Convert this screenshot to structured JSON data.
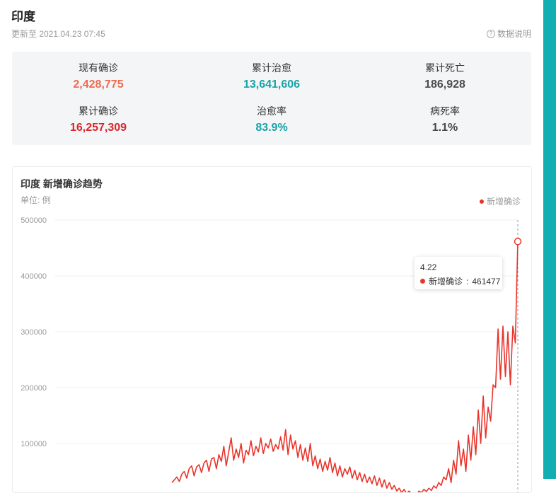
{
  "header": {
    "title": "印度",
    "update": "更新至 2021.04.23 07:45",
    "explain_label": "数据说明"
  },
  "stats": [
    {
      "label": "现有确诊",
      "value": "2,428,775",
      "color": "#f06a4f"
    },
    {
      "label": "累计治愈",
      "value": "13,641,606",
      "color": "#17a3a8"
    },
    {
      "label": "累计死亡",
      "value": "186,928",
      "color": "#4a4a4a"
    },
    {
      "label": "累计确诊",
      "value": "16,257,309",
      "color": "#d8262b"
    },
    {
      "label": "治愈率",
      "value": "83.9%",
      "color": "#17a3a8"
    },
    {
      "label": "病死率",
      "value": "1.1%",
      "color": "#4a4a4a"
    }
  ],
  "chart_card": {
    "title": "印度 新增确诊趋势",
    "unit": "单位: 例",
    "legend": "新增确诊",
    "tooltip": {
      "date": "4.22",
      "series": "新增确诊",
      "value": "461477"
    }
  },
  "chart_data": {
    "type": "line",
    "series_color": "#e9342c",
    "ylim": [
      0,
      500000
    ],
    "yticks": [
      "500000",
      "400000",
      "300000",
      "200000",
      "100000"
    ],
    "grid": true,
    "legend_position": "top-right",
    "series": [
      {
        "name": "新增确诊",
        "values": [
          30000,
          35000,
          40000,
          32000,
          45000,
          50000,
          38000,
          55000,
          60000,
          42000,
          58000,
          62000,
          48000,
          65000,
          70000,
          50000,
          72000,
          75000,
          55000,
          80000,
          68000,
          95000,
          60000,
          85000,
          110000,
          70000,
          90000,
          75000,
          100000,
          65000,
          88000,
          80000,
          105000,
          78000,
          95000,
          85000,
          110000,
          82000,
          100000,
          92000,
          108000,
          86000,
          98000,
          90000,
          112000,
          88000,
          125000,
          80000,
          115000,
          90000,
          105000,
          75000,
          98000,
          70000,
          92000,
          68000,
          100000,
          60000,
          78000,
          55000,
          72000,
          50000,
          68000,
          52000,
          75000,
          48000,
          65000,
          42000,
          60000,
          40000,
          55000,
          45000,
          58000,
          38000,
          52000,
          35000,
          48000,
          32000,
          45000,
          30000,
          40000,
          28000,
          42000,
          25000,
          38000,
          22000,
          35000,
          20000,
          30000,
          18000,
          25000,
          15000,
          20000,
          12000,
          18000,
          10000,
          15000,
          10000,
          12000,
          8000,
          15000,
          12000,
          18000,
          14000,
          20000,
          16000,
          24000,
          20000,
          30000,
          25000,
          40000,
          35000,
          55000,
          30000,
          70000,
          45000,
          105000,
          60000,
          90000,
          50000,
          115000,
          70000,
          130000,
          80000,
          160000,
          100000,
          185000,
          110000,
          165000,
          140000,
          205000,
          200000,
          305000,
          215000,
          310000,
          220000,
          300000,
          205000,
          310000,
          280000,
          461477
        ]
      }
    ]
  }
}
